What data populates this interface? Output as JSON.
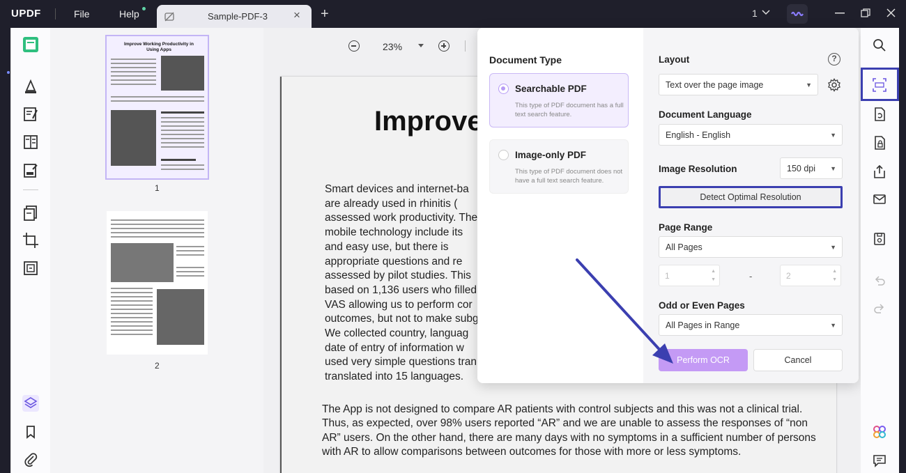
{
  "app": {
    "logo": "UPDF",
    "menu_file": "File",
    "menu_help": "Help",
    "tab_title": "Sample-PDF-3",
    "page_indicator": "1",
    "accent": "#7a8cff"
  },
  "zoom": {
    "value": "23%"
  },
  "thumbnails": [
    {
      "number": "1",
      "title": "Improve Working Productivity in Using Apps"
    },
    {
      "number": "2"
    }
  ],
  "document": {
    "title": "Improve",
    "para1": [
      "Smart devices and internet-ba",
      "are already used in rhinitis (",
      "assessed work productivity. The",
      "mobile technology include its",
      "and easy use, but there is",
      "appropriate questions and re",
      "assessed by pilot studies. This",
      "based on 1,136 users who filled",
      "VAS allowing us to perform cor",
      "outcomes, but not to make subg",
      "We collected country, languag",
      "date of entry of information w",
      "used very simple questions tran",
      "translated into 15 languages."
    ],
    "para2": "The App is not designed to compare AR patients with control subjects and this was not a clinical trial. Thus, as expected, over 98% users reported “AR” and we are unable to assess the responses of “non AR” users. On the other hand, there are many days with no symptoms in a sufficient number of persons with AR to allow comparisons between outcomes for those with more or less symptoms."
  },
  "ocr": {
    "document_type_heading": "Document Type",
    "types": [
      {
        "title": "Searchable PDF",
        "desc": "This type of PDF document has a full text search feature.",
        "selected": true
      },
      {
        "title": "Image-only PDF",
        "desc": "This type of PDF document does not have a full text search feature.",
        "selected": false
      }
    ],
    "layout_label": "Layout",
    "layout_value": "Text over the page image",
    "language_label": "Document Language",
    "language_value": "English - English",
    "resolution_label": "Image Resolution",
    "resolution_value": "150 dpi",
    "detect_button": "Detect Optimal Resolution",
    "page_range_label": "Page Range",
    "page_range_value": "All Pages",
    "range_from": "1",
    "range_to": "2",
    "range_dash": "-",
    "odd_even_label": "Odd or Even Pages",
    "odd_even_value": "All Pages in Range",
    "perform_button": "Perform OCR",
    "cancel_button": "Cancel",
    "primary_color": "#c49af5",
    "highlight_color": "#3b3fb0"
  }
}
